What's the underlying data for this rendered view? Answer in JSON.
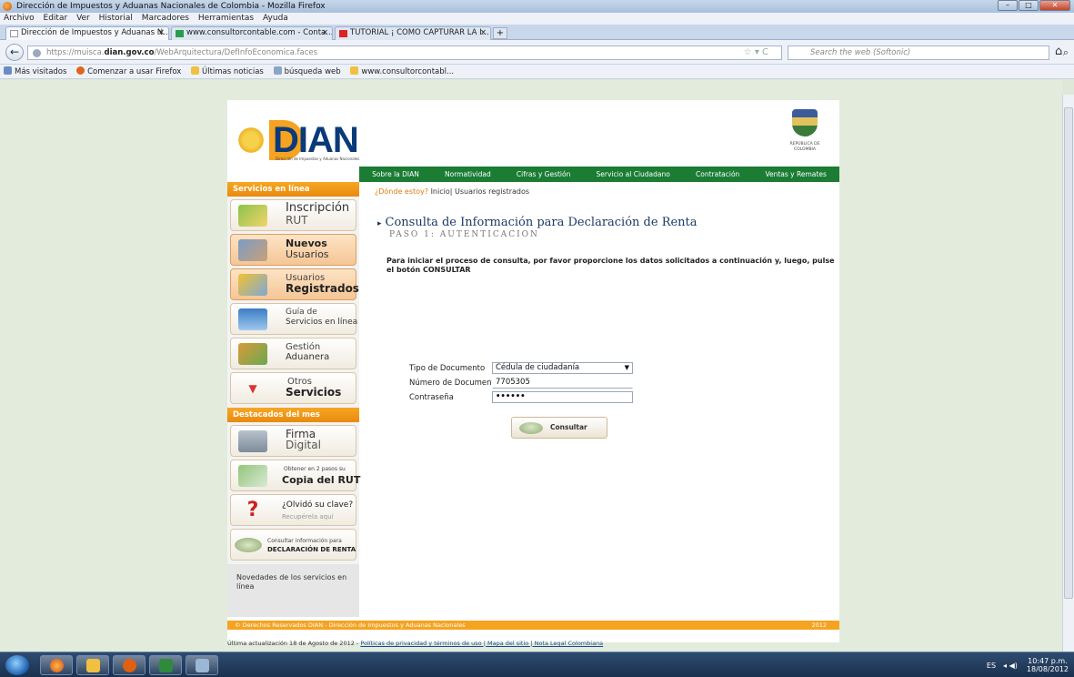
{
  "window": {
    "title": "Dirección de Impuestos y Aduanas Nacionales de Colombia - Mozilla Firefox",
    "controls": [
      "–",
      "□",
      "✕"
    ]
  },
  "menubar": [
    "Archivo",
    "Editar",
    "Ver",
    "Historial",
    "Marcadores",
    "Herramientas",
    "Ayuda"
  ],
  "tabs": [
    {
      "label": "Dirección de Impuestos y Aduanas N...",
      "close": "×"
    },
    {
      "label": "www.consultorcontable.com - Conta...",
      "close": "×"
    },
    {
      "label": "TUTORIAL ¡ COMO CAPTURAR LA I...",
      "close": "×"
    }
  ],
  "newtab": "+",
  "navbar": {
    "back": "←",
    "url_pre": "https://muisca.",
    "url_host": "dian.gov.co",
    "url_post": "/WebArquitectura/DefInfoEconomica.faces",
    "star": "☆ ▾ C",
    "search_placeholder": "Search the web (Softonic)",
    "search_icon": "⌕",
    "home_icon": "⌂"
  },
  "bookmarks": [
    "Más visitados",
    "Comenzar a usar Firefox",
    "Últimas noticias",
    "búsqueda web",
    "www.consultorcontabl..."
  ],
  "site": {
    "logo_text": "DIAN",
    "logo_sub": "Dirección de Impuestos y Aduanas Nacionales",
    "crest_text": "REPÚBLICA DE COLOMBIA",
    "topnav": [
      "Sobre la DIAN",
      "Normatividad",
      "Cifras y Gestión",
      "Servicio al Ciudadano",
      "Contratación",
      "Ventas y Remates"
    ],
    "sidebar_header": "Servicios en línea",
    "sidebar_buttons": [
      {
        "t1": "Inscripción",
        "t2": "RUT"
      },
      {
        "t1": "Nuevos",
        "t2": "Usuarios"
      },
      {
        "t1": "Usuarios",
        "t2": "Registrados"
      },
      {
        "t1": "Guía de",
        "t2": "Servicios en línea"
      },
      {
        "t1": "Gestión",
        "t2": "Aduanera"
      },
      {
        "t1": "Otros",
        "t2": "Servicios"
      }
    ],
    "destacados_header": "Destacados del mes",
    "destacados_buttons": [
      {
        "t1": "Firma",
        "t2": "Digital"
      },
      {
        "t1": "Obtener en 2 pasos su",
        "t2": "Copia del RUT"
      },
      {
        "t1": "¿Olvidó su clave?",
        "t2": "Recupérela aquí"
      },
      {
        "t1": "Consultar información para",
        "t2": "DECLARACIÓN DE RENTA"
      }
    ],
    "novedades": "Novedades de los servicios en línea",
    "breadcrumb_q": "¿Dónde estoy?",
    "breadcrumb_path": "Inicio| Usuarios registrados",
    "title": "Consulta de Información para Declaración de Renta",
    "title_marker": "▸",
    "paso": "PASO 1: AUTENTICACION",
    "instructions": "Para iniciar el proceso de consulta, por favor proporcione los datos solicitados a continuación y, luego, pulse el botón CONSULTAR",
    "form": {
      "tipo_label": "Tipo de Documento",
      "tipo_value": "Cédula de ciudadanía",
      "numero_label": "Número de Documento",
      "numero_value": "7705305",
      "pass_label": "Contraseña",
      "pass_value": "••••••",
      "submit": "Consultar"
    },
    "footer": "© Derechos Reservados DIAN - Dirección de Impuestos y Aduanas Nacionales",
    "footer_year": "2012",
    "lastupd_text": "Última actualización 18 de Agosto de 2012 - ",
    "lastupd_links": "Políticas de privacidad y términos de uso | Mapa del sitio | Nota Legal Colombiana"
  },
  "taskbar": {
    "lang": "ES",
    "time": "10:47 p.m.",
    "date": "18/08/2012"
  }
}
